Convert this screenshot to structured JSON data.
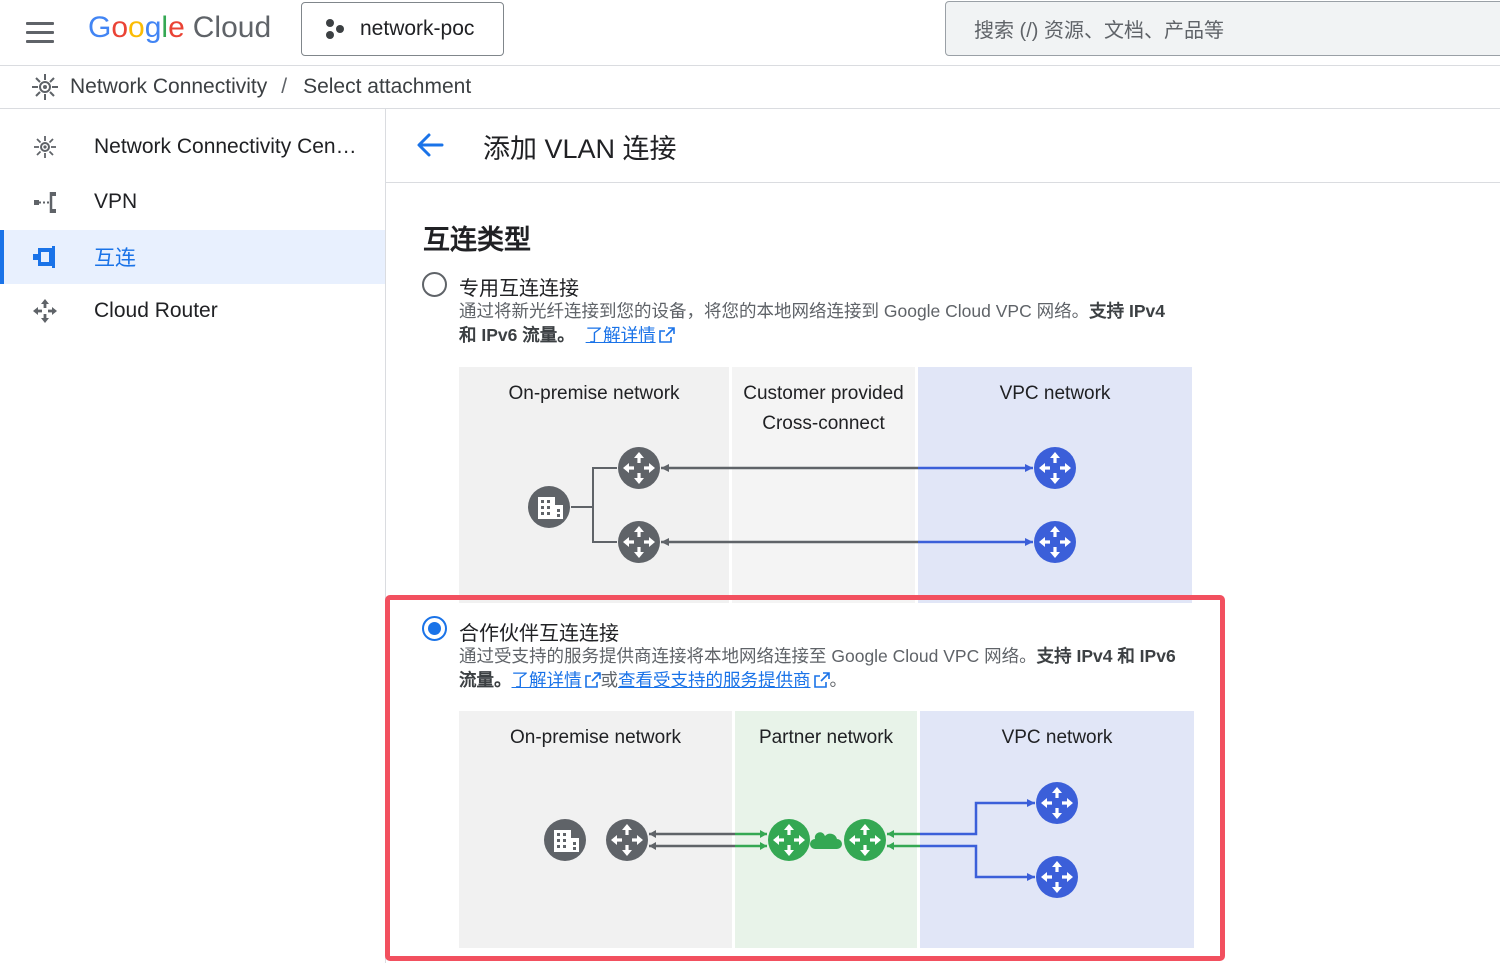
{
  "topbar": {
    "logo_letters": [
      "G",
      "o",
      "o",
      "g",
      "l",
      "e"
    ],
    "logo_product": "Cloud",
    "project_name": "network-poc",
    "search_placeholder": "搜索 (/) 资源、文档、产品等"
  },
  "breadcrumb": {
    "product": "Network Connectivity",
    "separator": "/",
    "current": "Select attachment"
  },
  "sidebar": {
    "items": [
      {
        "label": "Network Connectivity Cen…",
        "icon": "hub-icon"
      },
      {
        "label": "VPN",
        "icon": "vpn-icon"
      },
      {
        "label": "互连",
        "icon": "interconnect-icon",
        "active": true
      },
      {
        "label": "Cloud Router",
        "icon": "router-icon"
      }
    ]
  },
  "page": {
    "title": "添加 VLAN 连接",
    "section_title": "互连类型"
  },
  "options": {
    "dedicated": {
      "label": "专用互连连接",
      "selected": false,
      "desc_line1": "通过将新光纤连接到您的设备，将您的本地网络连接到 Google Cloud VPC 网络。",
      "desc_line1_bold": "支持 IPv4",
      "desc_line2_bold": "和 IPv6 流量。",
      "learn_more": "了解详情",
      "diagram": {
        "col1": "On-premise network",
        "col2_line1": "Customer provided",
        "col2_line2": "Cross-connect",
        "col3": "VPC network"
      }
    },
    "partner": {
      "label": "合作伙伴互连连接",
      "selected": true,
      "desc_line1": "通过受支持的服务提供商连接将本地网络连接至 Google Cloud VPC 网络。",
      "desc_line1_bold": "支持 IPv4 和 IPv6",
      "desc_line2_bold": "流量。",
      "learn_more": "了解详情",
      "or_text": "或",
      "providers_link": "查看受支持的服务提供商",
      "period": "。",
      "diagram": {
        "col1": "On-premise network",
        "col2": "Partner network",
        "col3": "VPC network"
      }
    }
  },
  "colors": {
    "accent": "#1a73e8",
    "router_gray": "#5f6368",
    "router_green": "#34a853",
    "router_blue": "#3b5fd9",
    "highlight": "#f2505f",
    "col_gray_bg": "#f1f1f1",
    "col_green_bg": "#e8f3e9",
    "col_blue_bg": "#e1e6f7"
  }
}
